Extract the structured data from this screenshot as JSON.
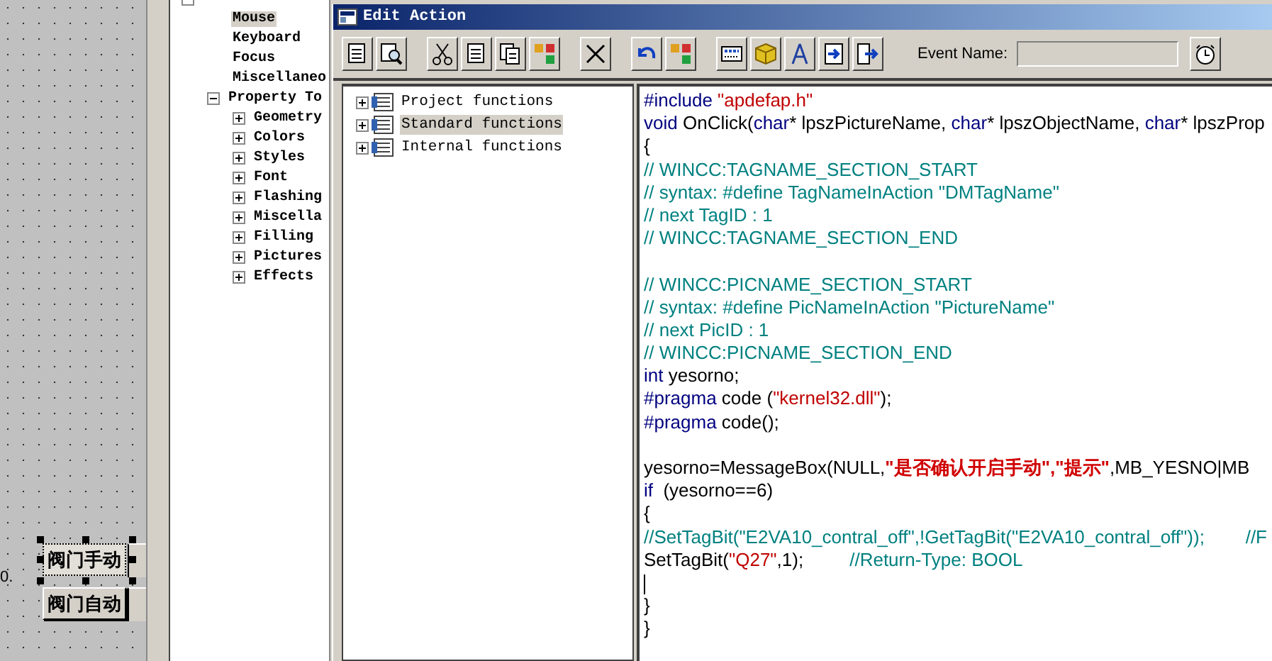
{
  "canvas": {
    "edge_label": "0.",
    "buttons": [
      {
        "label": "阀门手动",
        "selected": true
      },
      {
        "label": "阀门自动",
        "selected": false
      }
    ]
  },
  "object_tree": [
    {
      "expanded": true,
      "children": [
        {
          "label": "Mouse",
          "selected": true
        },
        {
          "label": "Keyboard",
          "selected": false
        },
        {
          "label": "Focus",
          "selected": false
        },
        {
          "label": "Miscellaneo",
          "selected": false
        },
        {
          "label": "Property To",
          "selected": false,
          "expanded": true,
          "children": [
            {
              "label": "Geometry",
              "selected": false,
              "expanded": false
            },
            {
              "label": "Colors",
              "selected": false,
              "expanded": false
            },
            {
              "label": "Styles",
              "selected": false,
              "expanded": false
            },
            {
              "label": "Font",
              "selected": false,
              "expanded": false
            },
            {
              "label": "Flashing",
              "selected": false,
              "expanded": false
            },
            {
              "label": "Miscella",
              "selected": false,
              "expanded": false
            },
            {
              "label": "Filling",
              "selected": false,
              "expanded": false
            },
            {
              "label": "Pictures",
              "selected": false,
              "expanded": false
            },
            {
              "label": "Effects",
              "selected": false,
              "expanded": false
            }
          ]
        }
      ]
    }
  ],
  "window": {
    "title": "Edit Action",
    "event_name_label": "Event Name:"
  },
  "function_tree": [
    {
      "label": "Project functions",
      "selected": false,
      "expanded": false
    },
    {
      "label": "Standard functions",
      "selected": true,
      "expanded": false
    },
    {
      "label": "Internal functions",
      "selected": false,
      "expanded": false
    }
  ],
  "code_lines": [
    {
      "kind": "code",
      "tokens": [
        {
          "kind": "keyword",
          "text": "#include"
        },
        {
          "kind": "string",
          "text": " \"apdefap.h\""
        }
      ]
    },
    {
      "kind": "code",
      "tokens": [
        {
          "kind": "keyword",
          "text": "void"
        },
        {
          "kind": "plain",
          "text": " OnClick("
        },
        {
          "kind": "keyword",
          "text": "char"
        },
        {
          "kind": "plain",
          "text": "* lpszPictureName, "
        },
        {
          "kind": "keyword",
          "text": "char"
        },
        {
          "kind": "plain",
          "text": "* lpszObjectName, "
        },
        {
          "kind": "keyword",
          "text": "char"
        },
        {
          "kind": "plain",
          "text": "* lpszProp"
        }
      ]
    },
    {
      "kind": "code",
      "tokens": [
        {
          "kind": "plain",
          "text": "{"
        }
      ]
    },
    {
      "kind": "code",
      "tokens": [
        {
          "kind": "comment",
          "text": "// WINCC:TAGNAME_SECTION_START"
        }
      ]
    },
    {
      "kind": "code",
      "tokens": [
        {
          "kind": "comment",
          "text": "// syntax: #define TagNameInAction \"DMTagName\""
        }
      ]
    },
    {
      "kind": "code",
      "tokens": [
        {
          "kind": "comment",
          "text": "// next TagID : 1"
        }
      ]
    },
    {
      "kind": "code",
      "tokens": [
        {
          "kind": "comment",
          "text": "// WINCC:TAGNAME_SECTION_END"
        }
      ]
    },
    {
      "kind": "blank"
    },
    {
      "kind": "code",
      "tokens": [
        {
          "kind": "comment",
          "text": "// WINCC:PICNAME_SECTION_START"
        }
      ]
    },
    {
      "kind": "code",
      "tokens": [
        {
          "kind": "comment",
          "text": "// syntax: #define PicNameInAction \"PictureName\""
        }
      ]
    },
    {
      "kind": "code",
      "tokens": [
        {
          "kind": "comment",
          "text": "// next PicID : 1"
        }
      ]
    },
    {
      "kind": "code",
      "tokens": [
        {
          "kind": "comment",
          "text": "// WINCC:PICNAME_SECTION_END"
        }
      ]
    },
    {
      "kind": "code",
      "tokens": [
        {
          "kind": "keyword",
          "text": "int"
        },
        {
          "kind": "plain",
          "text": " yesorno;"
        }
      ]
    },
    {
      "kind": "code",
      "tokens": [
        {
          "kind": "keyword",
          "text": "#pragma"
        },
        {
          "kind": "plain",
          "text": " code ("
        },
        {
          "kind": "string",
          "text": "\"kernel32.dll\""
        },
        {
          "kind": "plain",
          "text": ");"
        }
      ]
    },
    {
      "kind": "code",
      "tokens": [
        {
          "kind": "keyword",
          "text": "#pragma"
        },
        {
          "kind": "plain",
          "text": " code();"
        }
      ]
    },
    {
      "kind": "blank"
    },
    {
      "kind": "code",
      "tokens": [
        {
          "kind": "plain",
          "text": "yesorno=MessageBox(NULL,"
        },
        {
          "kind": "cjk-string",
          "text": "\"是否确认开启手动\",\"提示\""
        },
        {
          "kind": "plain",
          "text": ",MB_YESNO|MB"
        }
      ]
    },
    {
      "kind": "code",
      "tokens": [
        {
          "kind": "keyword",
          "text": "if"
        },
        {
          "kind": "plain",
          "text": "  (yesorno==6)"
        }
      ]
    },
    {
      "kind": "code",
      "tokens": [
        {
          "kind": "plain",
          "text": "{"
        }
      ]
    },
    {
      "kind": "code",
      "tokens": [
        {
          "kind": "comment",
          "text": "//SetTagBit(\"E2VA10_contral_off\",!GetTagBit(\"E2VA10_contral_off\"));        //F"
        }
      ]
    },
    {
      "kind": "code",
      "tokens": [
        {
          "kind": "plain",
          "text": "SetTagBit("
        },
        {
          "kind": "string",
          "text": "\"Q27\""
        },
        {
          "kind": "plain",
          "text": ",1);"
        },
        {
          "kind": "comment",
          "text": "         //Return-Type: BOOL"
        }
      ]
    },
    {
      "kind": "cursor"
    },
    {
      "kind": "code",
      "tokens": [
        {
          "kind": "plain",
          "text": "}"
        }
      ]
    },
    {
      "kind": "code",
      "tokens": [
        {
          "kind": "plain",
          "text": "}"
        }
      ]
    }
  ]
}
